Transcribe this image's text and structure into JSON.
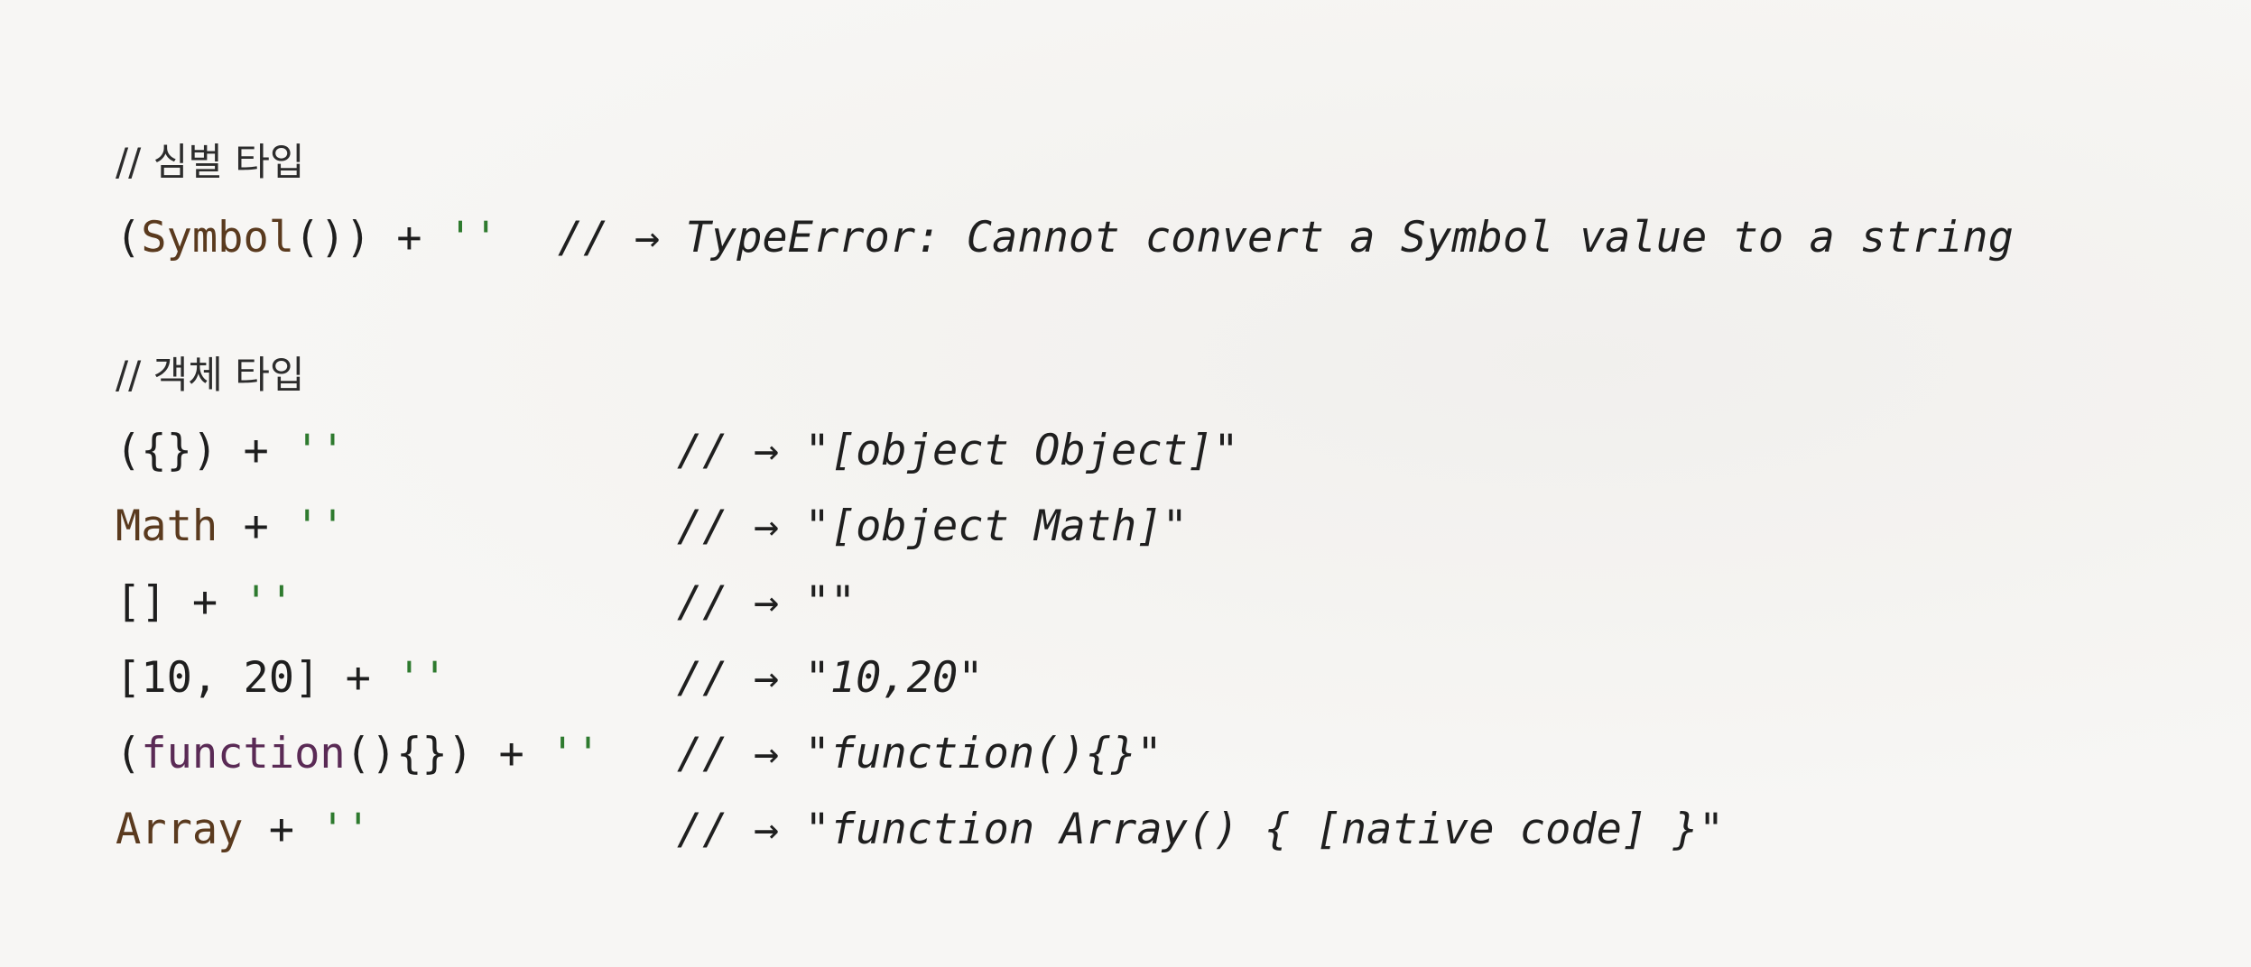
{
  "sections": [
    {
      "comment": "// 심벌 타입",
      "lines": [
        {
          "expr_parts": [
            {
              "text": "(",
              "cls": "plain"
            },
            {
              "text": "Symbol",
              "cls": "kw"
            },
            {
              "text": "()) + ",
              "cls": "plain"
            },
            {
              "text": "''",
              "cls": "str"
            }
          ],
          "result": "// → TypeError: Cannot convert a Symbol value to a string",
          "result_col": "col-a"
        }
      ]
    },
    {
      "comment": "// 객체 타입",
      "lines": [
        {
          "expr_parts": [
            {
              "text": "({}) + ",
              "cls": "plain"
            },
            {
              "text": "''",
              "cls": "str"
            }
          ],
          "result": "// → \"[object Object]\"",
          "result_col": "col-b"
        },
        {
          "expr_parts": [
            {
              "text": "Math",
              "cls": "kw"
            },
            {
              "text": " + ",
              "cls": "plain"
            },
            {
              "text": "''",
              "cls": "str"
            }
          ],
          "result": "// → \"[object Math]\"",
          "result_col": "col-b"
        },
        {
          "expr_parts": [
            {
              "text": "[] + ",
              "cls": "plain"
            },
            {
              "text": "''",
              "cls": "str"
            }
          ],
          "result": "// → \"\"",
          "result_col": "col-b"
        },
        {
          "expr_parts": [
            {
              "text": "[10, 20] + ",
              "cls": "plain"
            },
            {
              "text": "''",
              "cls": "str"
            }
          ],
          "result": "// → \"10,20\"",
          "result_col": "col-b"
        },
        {
          "expr_parts": [
            {
              "text": "(",
              "cls": "plain"
            },
            {
              "text": "function",
              "cls": "fn"
            },
            {
              "text": "(){}) + ",
              "cls": "plain"
            },
            {
              "text": "''",
              "cls": "str"
            }
          ],
          "result": "// → \"function(){}\"",
          "result_col": "col-b"
        },
        {
          "expr_parts": [
            {
              "text": "Array",
              "cls": "kw"
            },
            {
              "text": " + ",
              "cls": "plain"
            },
            {
              "text": "''",
              "cls": "str"
            }
          ],
          "result": "// → \"function Array() { [native code] }\"",
          "result_col": "col-b"
        }
      ]
    }
  ]
}
